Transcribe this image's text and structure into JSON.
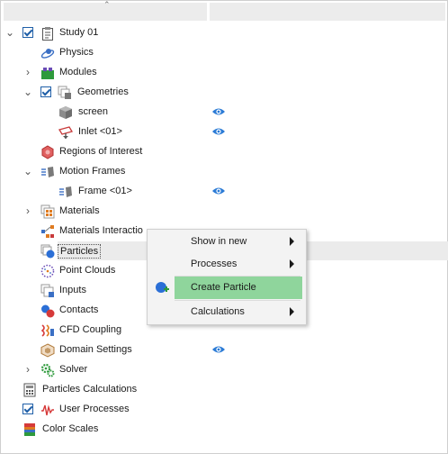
{
  "tree": {
    "items": [
      {
        "label": "Study 01",
        "icon": "clipboard-icon"
      },
      {
        "label": "Physics",
        "icon": "physics-icon"
      },
      {
        "label": "Modules",
        "icon": "puzzle-icon"
      },
      {
        "label": "Geometries",
        "icon": "geometries-icon"
      },
      {
        "label": "screen",
        "icon": "cube-icon"
      },
      {
        "label": "Inlet <01>",
        "icon": "inlet-icon"
      },
      {
        "label": "Regions of Interest",
        "icon": "hexagon-icon"
      },
      {
        "label": "Motion Frames",
        "icon": "motion-frame-icon"
      },
      {
        "label": "Frame <01>",
        "icon": "frame-icon"
      },
      {
        "label": "Materials",
        "icon": "materials-icon"
      },
      {
        "label": "Materials Interactio",
        "icon": "materials-interaction-icon"
      },
      {
        "label": "Particles",
        "icon": "particles-icon"
      },
      {
        "label": "Point Clouds",
        "icon": "point-cloud-icon"
      },
      {
        "label": "Inputs",
        "icon": "inputs-icon"
      },
      {
        "label": "Contacts",
        "icon": "contacts-icon"
      },
      {
        "label": "CFD Coupling",
        "icon": "cfd-icon"
      },
      {
        "label": "Domain Settings",
        "icon": "domain-icon"
      },
      {
        "label": "Solver",
        "icon": "gears-icon"
      },
      {
        "label": "Particles Calculations",
        "icon": "calculator-icon"
      },
      {
        "label": "User Processes",
        "icon": "waveform-icon"
      },
      {
        "label": "Color Scales",
        "icon": "color-scale-icon"
      }
    ]
  },
  "context_menu": {
    "items": [
      {
        "label": "Show in new",
        "submenu": true
      },
      {
        "label": "Processes",
        "submenu": true
      },
      {
        "label": "Create Particle",
        "submenu": false,
        "icon": "add-particle-icon"
      },
      {
        "label": "Calculations",
        "submenu": true
      }
    ]
  },
  "colors": {
    "selected_menu_item": "#8fd59c",
    "checkbox": "#1f5fa8",
    "eye_icon": "#2b7bd6"
  }
}
